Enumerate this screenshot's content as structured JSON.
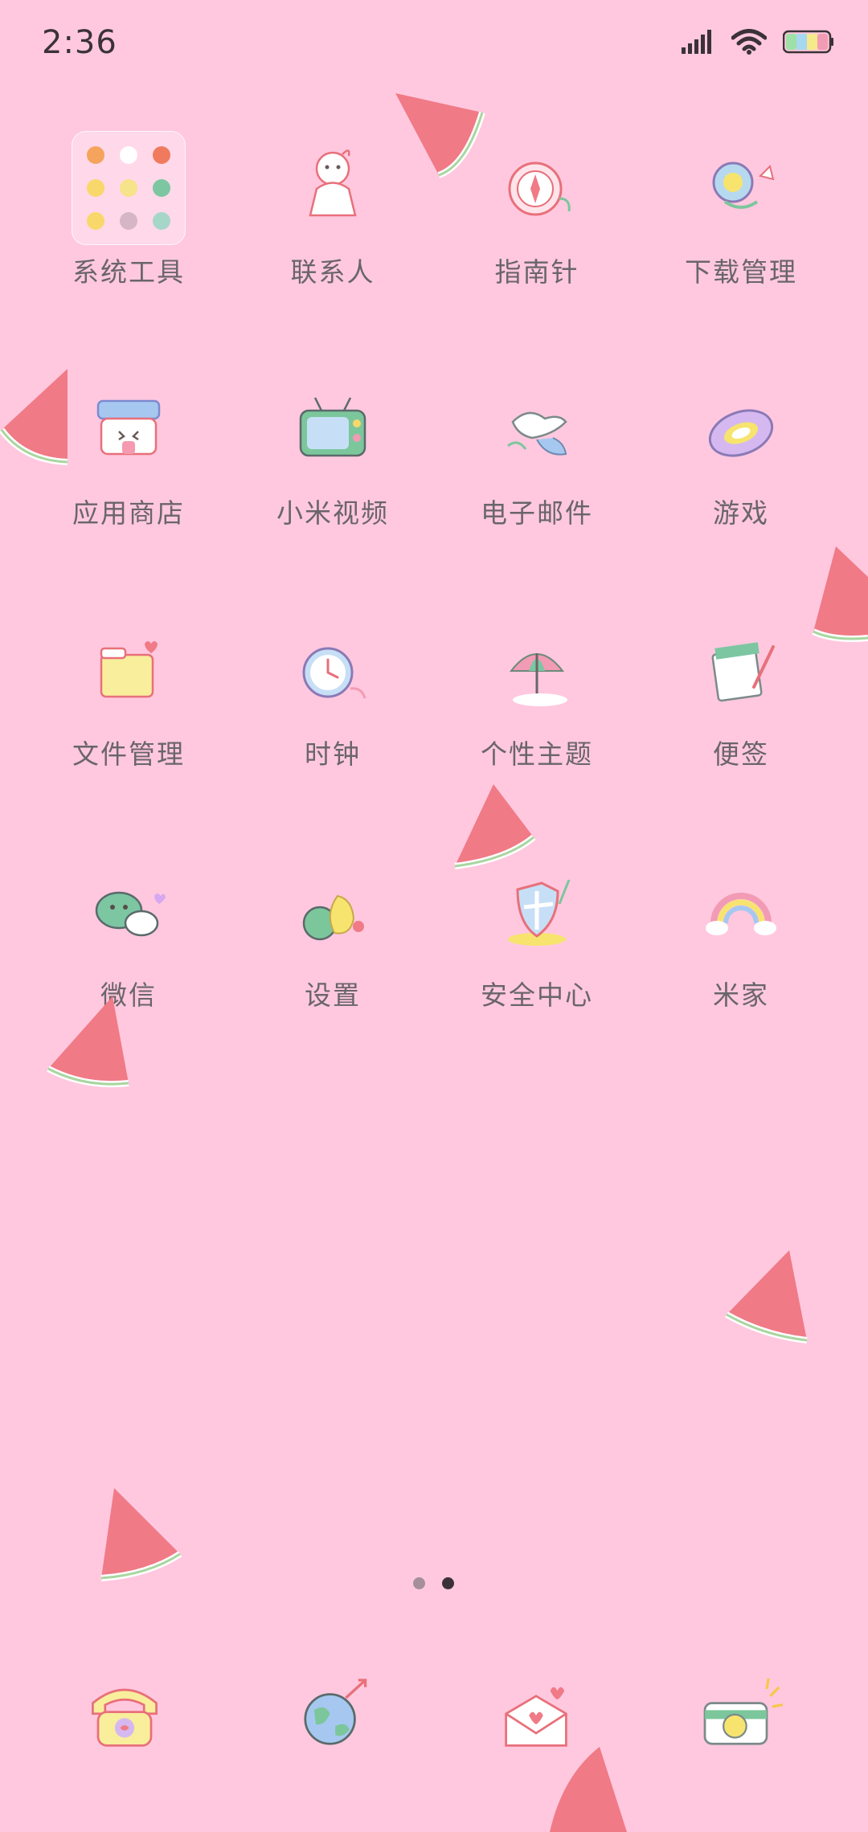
{
  "status_bar": {
    "time": "2:36",
    "signal_icon": "signal-icon",
    "wifi_icon": "wifi-icon",
    "battery_icon": "battery-icon"
  },
  "apps": [
    {
      "label": "系统工具",
      "icon": "folder-icon"
    },
    {
      "label": "联系人",
      "icon": "contacts-icon"
    },
    {
      "label": "指南针",
      "icon": "compass-icon"
    },
    {
      "label": "下载管理",
      "icon": "download-manager-icon"
    },
    {
      "label": "应用商店",
      "icon": "app-store-icon"
    },
    {
      "label": "小米视频",
      "icon": "video-icon"
    },
    {
      "label": "电子邮件",
      "icon": "email-icon"
    },
    {
      "label": "游戏",
      "icon": "game-icon"
    },
    {
      "label": "文件管理",
      "icon": "file-manager-icon"
    },
    {
      "label": "时钟",
      "icon": "clock-icon"
    },
    {
      "label": "个性主题",
      "icon": "theme-icon"
    },
    {
      "label": "便签",
      "icon": "notes-icon"
    },
    {
      "label": "微信",
      "icon": "wechat-icon"
    },
    {
      "label": "设置",
      "icon": "settings-icon"
    },
    {
      "label": "安全中心",
      "icon": "security-icon"
    },
    {
      "label": "米家",
      "icon": "mijia-icon"
    }
  ],
  "dock": [
    {
      "icon": "phone-icon"
    },
    {
      "icon": "browser-globe-icon"
    },
    {
      "icon": "messages-icon"
    },
    {
      "icon": "camera-icon"
    }
  ],
  "pager": {
    "pages": 2,
    "current": 2
  },
  "colors": {
    "background": "#ffc8df",
    "label": "#6a6569",
    "accent": "#f07a86"
  }
}
